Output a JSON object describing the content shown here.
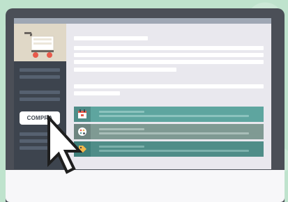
{
  "sidebar": {
    "buy_button_label": "COMPRA"
  },
  "icons": {
    "cart": "shopping-cart-icon",
    "calendar": "calendar-icon",
    "palette": "palette-icon",
    "tag": "tag-icon",
    "cursor": "cursor-icon"
  },
  "colors": {
    "background": "#bfe3cd",
    "monitor_frame": "#4b4f57",
    "screen_bg": "#e9e8ee",
    "sidebar": "#3d444e",
    "cart_panel": "#e0d8c7",
    "teal_row": "#5ea59f",
    "teal_row_dark": "#4f8d88",
    "gray_row": "#7f9a93",
    "accent_red": "#e85a4b"
  },
  "list": {
    "rows": [
      {
        "icon": "calendar-icon"
      },
      {
        "icon": "palette-icon"
      },
      {
        "icon": "tag-icon"
      }
    ]
  }
}
